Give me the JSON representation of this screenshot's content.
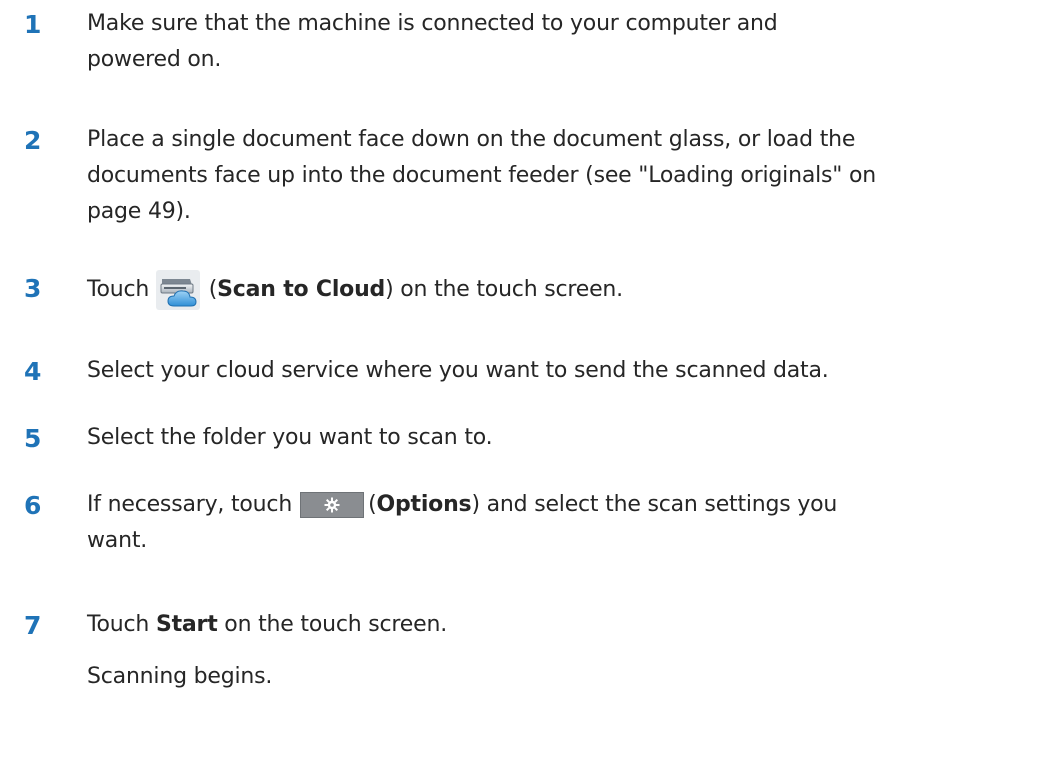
{
  "steps": [
    {
      "num": "1",
      "lines": [
        "Make sure that the machine is connected to your computer and",
        "powered on."
      ]
    },
    {
      "num": "2",
      "lines": [
        "Place a single document face down on the document glass, or load the",
        "documents face up into the document feeder (see \"Loading originals\" on",
        "page 49)."
      ]
    },
    {
      "num": "3",
      "prefix": "Touch",
      "icon": "scan-to-cloud-icon",
      "paren_open": "(",
      "bold": "Scan to Cloud",
      "suffix": ") on the touch screen."
    },
    {
      "num": "4",
      "lines": [
        "Select your cloud service where you want to send the scanned data."
      ]
    },
    {
      "num": "5",
      "lines": [
        "Select the folder you want to scan to."
      ]
    },
    {
      "num": "6",
      "prefix": "If necessary, touch",
      "icon": "options-gear-icon",
      "paren_open": "(",
      "bold": "Options",
      "suffix": ") and select the scan settings you",
      "line2": "want."
    },
    {
      "num": "7",
      "prefix": "Touch ",
      "bold": "Start",
      "suffix": " on the touch screen."
    }
  ],
  "result": "Scanning begins.",
  "colors": {
    "step_number": "#1f73b7",
    "body_text": "#262626"
  }
}
